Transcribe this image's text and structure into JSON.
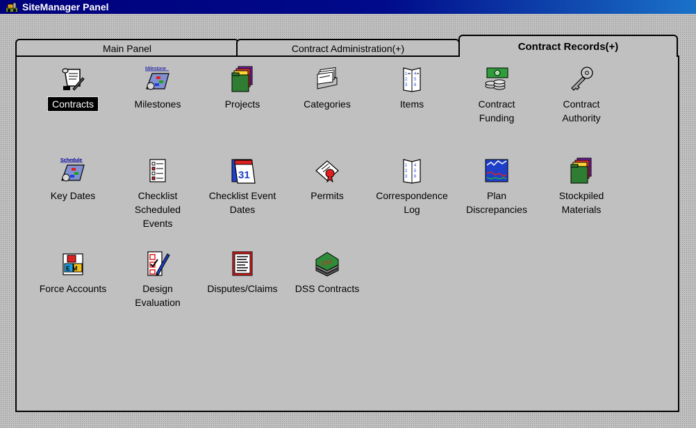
{
  "window": {
    "title": "SiteManager Panel"
  },
  "tabs": [
    {
      "label": "Main Panel",
      "active": false
    },
    {
      "label": "Contract Administration(+)",
      "active": false
    },
    {
      "label": "Contract Records(+)",
      "active": true
    }
  ],
  "items": [
    {
      "label": "Contracts",
      "icon": "contracts-scroll-icon",
      "selected": true
    },
    {
      "label": "Milestones",
      "icon": "milestones-icon",
      "badge": "Milestone"
    },
    {
      "label": "Projects",
      "icon": "projects-folders-icon"
    },
    {
      "label": "Categories",
      "icon": "categories-cardfile-icon"
    },
    {
      "label": "Items",
      "icon": "items-booklet-icon"
    },
    {
      "label": "Contract\nFunding",
      "icon": "contract-funding-money-icon"
    },
    {
      "label": "Contract\nAuthority",
      "icon": "contract-authority-key-icon"
    },
    {
      "label": "Key Dates",
      "icon": "key-dates-schedule-icon",
      "badge": "Schedule"
    },
    {
      "label": "Checklist\nScheduled\nEvents",
      "icon": "checklist-scheduled-events-icon"
    },
    {
      "label": "Checklist Event\nDates",
      "icon": "checklist-event-dates-calendar-icon",
      "badge": "31"
    },
    {
      "label": "Permits",
      "icon": "permits-certificate-icon"
    },
    {
      "label": "Correspondence\nLog",
      "icon": "correspondence-log-booklet-icon"
    },
    {
      "label": "Plan\nDiscrepancies",
      "icon": "plan-discrepancies-chart-icon"
    },
    {
      "label": "Stockpiled\nMaterials",
      "icon": "stockpiled-materials-folders-icon"
    },
    {
      "label": "Force Accounts",
      "icon": "force-accounts-blocks-icon",
      "badge": "EM"
    },
    {
      "label": "Design\nEvaluation",
      "icon": "design-evaluation-checklist-icon"
    },
    {
      "label": "Disputes/Claims",
      "icon": "disputes-claims-document-icon"
    },
    {
      "label": "DSS Contracts",
      "icon": "dss-contracts-stack-icon",
      "badge": "DSS"
    }
  ],
  "colors": {
    "titlebar_start": "#00007b",
    "titlebar_end": "#1a72c8",
    "face": "#c0c0c0",
    "selection": "#000000"
  }
}
